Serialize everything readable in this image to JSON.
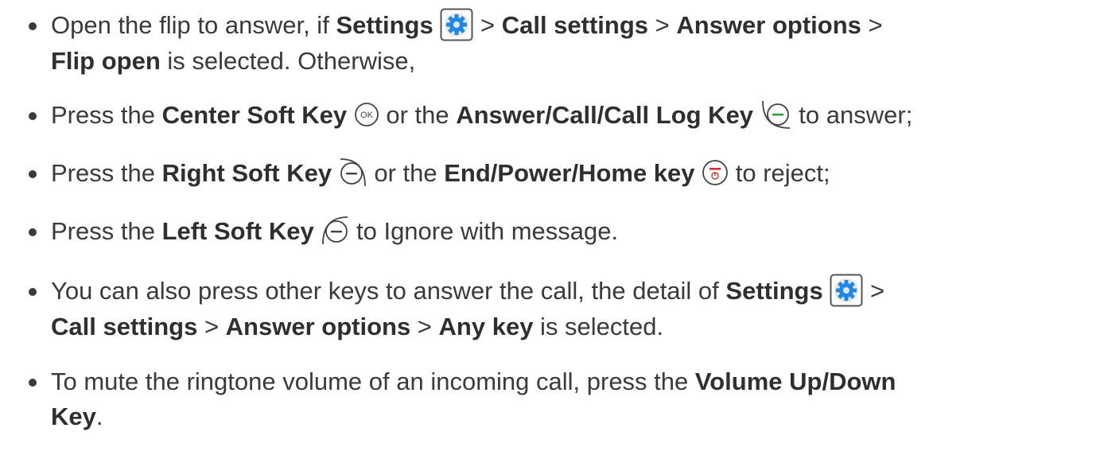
{
  "items": [
    {
      "line1": {
        "t0": "Open the flip to answer, if ",
        "b0": "Settings",
        "t1": " > ",
        "b1": "Call settings",
        "t2": " > ",
        "b2": "Answer options",
        "t3": " >"
      },
      "line2": {
        "b0": "Flip open",
        "t0": " is selected. Otherwise,"
      }
    },
    {
      "t0": "Press the ",
      "b0": "Center Soft Key",
      "t1": " or the ",
      "b1": "Answer/Call/Call Log Key",
      "t2": " to answer;"
    },
    {
      "t0": "Press the ",
      "b0": "Right Soft Key",
      "t1": " or the ",
      "b1": "End/Power/Home key",
      "t2": " to reject;"
    },
    {
      "t0": "Press the ",
      "b0": "Left Soft Key",
      "t1": " to Ignore with message."
    },
    {
      "line1": {
        "t0": "You can also press other keys to answer the call, the detail of ",
        "b0": "Settings",
        "t1": " >"
      },
      "line2": {
        "b0": "Call settings",
        "t0": " > ",
        "b1": "Answer options",
        "t1": " > ",
        "b2": "Any key",
        "t2": " is selected."
      }
    },
    {
      "line1": {
        "t0": "To mute the ringtone volume of an incoming call, press the ",
        "b0": "Volume Up/Down"
      },
      "line2": {
        "b0": "Key",
        "t0": "."
      }
    }
  ],
  "icons": {
    "settings": "settings-gear-icon",
    "ok_key": "ok-key-icon",
    "call_key": "call-key-icon",
    "right_soft_key": "right-soft-key-icon",
    "end_key": "end-power-key-icon",
    "left_soft_key": "left-soft-key-icon",
    "ok_label": "OK"
  },
  "colors": {
    "text": "#3a3a3a",
    "gear_blue": "#1e88e5",
    "call_green": "#2e9e3e",
    "end_red": "#d32f2f"
  }
}
